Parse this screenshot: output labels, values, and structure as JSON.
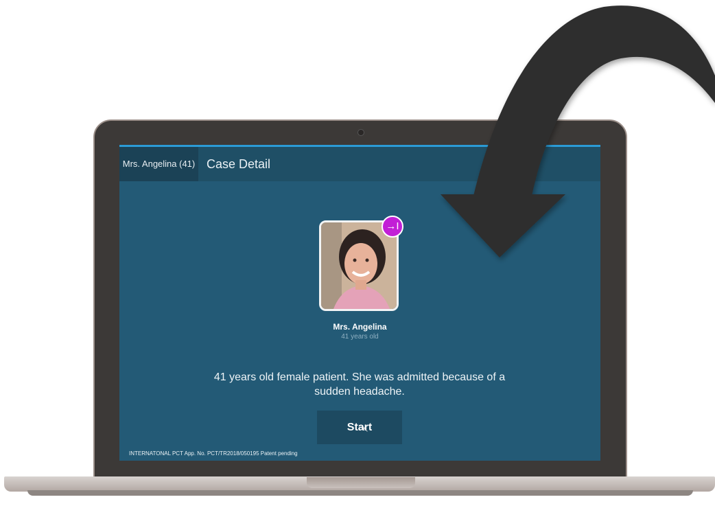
{
  "window": {
    "tab_label": "Mrs. Angelina (41)",
    "title": "Case Detail"
  },
  "patient": {
    "name": "Mrs. Angelina",
    "age_text": "41 years old",
    "badge_icon": "arrow-right-to-bar-icon",
    "badge_glyph": "→I"
  },
  "case": {
    "description": "41 years old female patient. She was admitted because of a sudden headache."
  },
  "actions": {
    "start_label": "Start"
  },
  "footer": {
    "text": "INTERNATONAL PCT App. No. PCT/TR2018/050195 Patent pending"
  },
  "colors": {
    "accent": "#2b9bd6",
    "screen_bg": "#235a76",
    "appbar_bg": "#1f4f66",
    "badge": "#c21fd6"
  }
}
